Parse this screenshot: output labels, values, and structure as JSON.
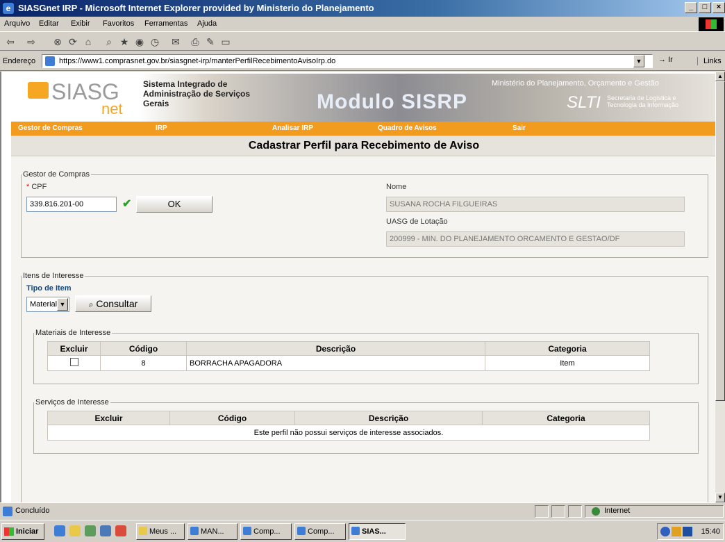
{
  "window": {
    "title": "SIASGnet IRP - Microsoft Internet Explorer provided by Ministerio do Planejamento",
    "controls": [
      "_",
      "□",
      "×"
    ]
  },
  "menu": [
    "Arquivo",
    "Editar",
    "Exibir",
    "Favoritos",
    "Ferramentas",
    "Ajuda"
  ],
  "address": {
    "label": "Endereço",
    "url": "https://www1.comprasnet.gov.br/siasgnet-irp/manterPerfilRecebimentoAvisoIrp.do",
    "go": "Ir",
    "links": "Links"
  },
  "banner": {
    "logo": "SIASG",
    "logo_sub": "net",
    "system_name": "Sistema Integrado de Administração de Serviços Gerais",
    "module": "Modulo SISRP",
    "ministry": "Ministério do Planejamento, Orçamento e Gestão",
    "slti": "SLTI",
    "slti_sub": "Secretaria de Logística e Tecnologia da Informação"
  },
  "nav": [
    "Gestor de Compras",
    "IRP",
    "Analisar IRP",
    "Quadro de Avisos",
    "Sair"
  ],
  "page_title": "Cadastrar Perfil para Recebimento de Aviso",
  "gestor": {
    "legend": "Gestor de Compras",
    "required_mark": "*",
    "cpf_label": "CPF",
    "cpf_value": "339.816.201-00",
    "ok_label": "OK",
    "nome_label": "Nome",
    "nome_value": "SUSANA ROCHA FILGUEIRAS",
    "uasg_label": "UASG de Lotação",
    "uasg_value": "200999 - MIN. DO PLANEJAMENTO ORCAMENTO E GESTAO/DF"
  },
  "itens": {
    "legend": "Itens de Interesse",
    "tipo_label": "Tipo de Item",
    "tipo_selected": "Material",
    "consultar_label": "Consultar"
  },
  "materiais": {
    "legend": "Materiais de Interesse",
    "headers": [
      "Excluir",
      "Código",
      "Descrição",
      "Categoria"
    ],
    "rows": [
      {
        "codigo": "8",
        "descricao": "BORRACHA APAGADORA",
        "categoria": "Item"
      }
    ]
  },
  "servicos": {
    "legend": "Serviços de Interesse",
    "headers": [
      "Excluir",
      "Código",
      "Descrição",
      "Categoria"
    ],
    "empty_message": "Este perfil não possui serviços de interesse associados."
  },
  "status": {
    "text": "Concluído",
    "zone": "Internet"
  },
  "taskbar": {
    "start": "Iniciar",
    "tasks": [
      "Meus ...",
      "MAN...",
      "Comp...",
      "Comp...",
      "SIAS..."
    ],
    "clock": "15:40"
  }
}
